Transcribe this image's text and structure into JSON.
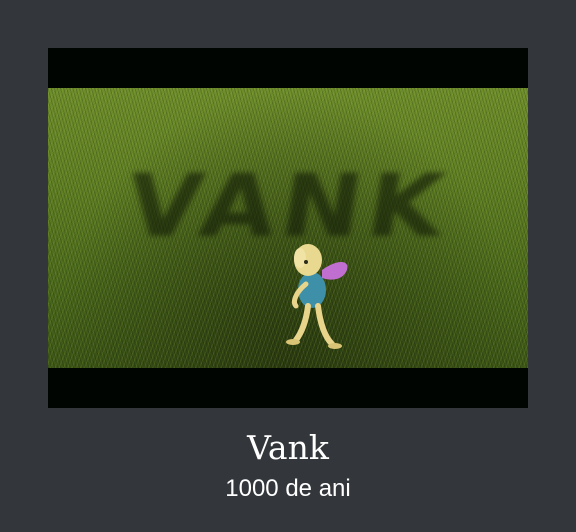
{
  "item": {
    "title": "Vank",
    "subtitle": "1000 de ani",
    "thumbnail": {
      "scene_text": "VANK",
      "letterbox_color": "#000501",
      "grass_color": "#5f7f24"
    }
  }
}
